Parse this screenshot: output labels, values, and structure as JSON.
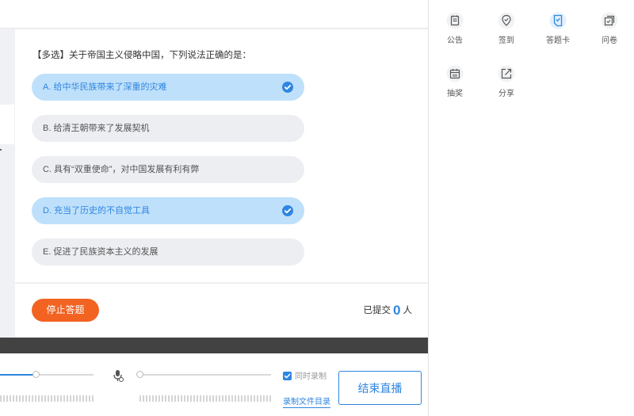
{
  "quiz": {
    "question": "【多选】关于帝国主义侵略中国，下列说法正确的是：",
    "options": [
      {
        "label": "A. 给中华民族带来了深重的灾难",
        "selected": true
      },
      {
        "label": "B. 给清王朝带来了发展契机",
        "selected": false
      },
      {
        "label": "C. 具有“双重使命”，对中国发展有利有弊",
        "selected": false
      },
      {
        "label": "D. 充当了历史的不自觉工具",
        "selected": true
      },
      {
        "label": "E. 促进了民族资本主义的发展",
        "selected": false
      }
    ],
    "stop_label": "停止答题",
    "submitted_prefix": "已提交",
    "submitted_count": "0",
    "submitted_suffix": "人"
  },
  "controls": {
    "volume_level": 0.38,
    "mic_level": 0.0,
    "sync_record_label": "同时录制",
    "sync_record_checked": true,
    "record_dir_label": "录制文件目录",
    "end_live_label": "结束直播"
  },
  "tools": [
    {
      "label": "公告",
      "icon": "announcement-icon"
    },
    {
      "label": "签到",
      "icon": "checkin-icon"
    },
    {
      "label": "答题卡",
      "icon": "answer-card-icon"
    },
    {
      "label": "问卷",
      "icon": "questionnaire-icon"
    },
    {
      "label": "抽奖",
      "icon": "lottery-icon"
    },
    {
      "label": "分享",
      "icon": "share-icon"
    }
  ],
  "colors": {
    "accent": "#2f86e0",
    "stop": "#f26322",
    "selected_bg": "#bfe0fb"
  }
}
